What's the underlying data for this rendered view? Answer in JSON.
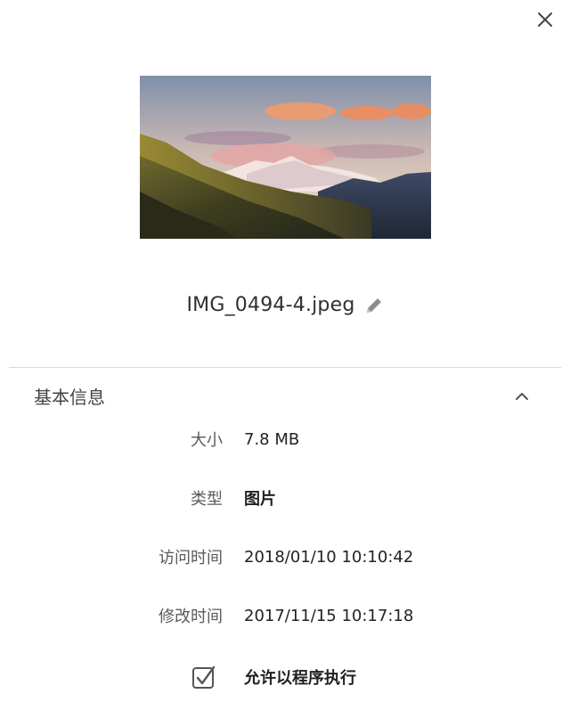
{
  "dialog": {
    "close_icon": "close-icon"
  },
  "preview": {
    "icon": "image-thumbnail"
  },
  "file": {
    "name": "IMG_0494-4.jpeg",
    "edit_icon": "pencil-icon"
  },
  "section": {
    "title": "基本信息",
    "collapse_icon": "chevron-up-icon",
    "expanded": true
  },
  "info": [
    {
      "label": "大小",
      "value": "7.8 MB"
    },
    {
      "label": "类型",
      "value": "图片"
    },
    {
      "label": "访问时间",
      "value": "2018/01/10 10:10:42"
    },
    {
      "label": "修改时间",
      "value": "2017/11/15 10:17:18"
    }
  ],
  "executable": {
    "label": "允许以程序执行",
    "checked": true
  }
}
